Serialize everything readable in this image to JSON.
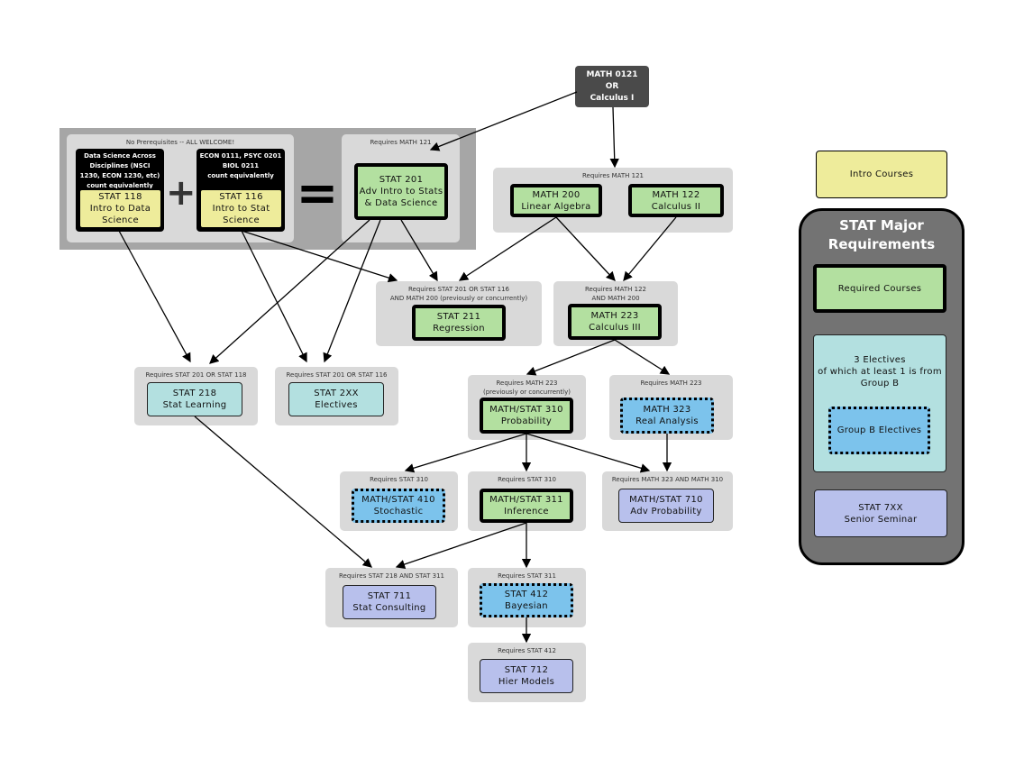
{
  "top_prereq": {
    "label": "MATH 0121\nOR\nCalculus I"
  },
  "intro_block": {
    "panel_label": "No Prerequisites -- ALL WELCOME!",
    "equivalents_118": "Data Science Across Disciplines (NSCI 1230, ECON 1230, etc) count equivalently",
    "equivalents_116": "ECON 0111, PSYC 0201\nBIOL 0211\ncount equivalently",
    "plus": "+",
    "equals": "="
  },
  "groups": [
    {
      "id": "g118",
      "courses": [
        {
          "code": "STAT 118",
          "name": "Intro to Data Science",
          "type": "intro"
        }
      ]
    },
    {
      "id": "g116",
      "courses": [
        {
          "code": "STAT 116",
          "name": "Intro to Stat Science",
          "type": "intro"
        }
      ]
    },
    {
      "id": "g201",
      "requires": "Requires MATH 121",
      "courses": [
        {
          "code": "STAT 201",
          "name": "Adv Intro to Stats & Data Science",
          "type": "required"
        }
      ]
    },
    {
      "id": "gmath",
      "requires": "Requires MATH 121",
      "courses": [
        {
          "code": "MATH 200",
          "name": "Linear Algebra",
          "type": "required"
        },
        {
          "code": "MATH 122",
          "name": "Calculus II",
          "type": "required"
        }
      ]
    },
    {
      "id": "g211",
      "requires": "Requires STAT 201 OR STAT 116\nAND MATH 200 (previously or concurrently)",
      "courses": [
        {
          "code": "STAT 211",
          "name": "Regression",
          "type": "required"
        }
      ]
    },
    {
      "id": "g223",
      "requires": "Requires MATH 122\nAND MATH 200",
      "courses": [
        {
          "code": "MATH 223",
          "name": "Calculus III",
          "type": "required"
        }
      ]
    },
    {
      "id": "g218",
      "requires": "Requires STAT 201 OR STAT 118",
      "courses": [
        {
          "code": "STAT 218",
          "name": "Stat Learning",
          "type": "elective"
        }
      ]
    },
    {
      "id": "g2xx",
      "requires": "Requires STAT 201 OR STAT 116",
      "courses": [
        {
          "code": "STAT 2XX",
          "name": "Electives",
          "type": "elective"
        }
      ]
    },
    {
      "id": "g310",
      "requires": "Requires MATH 223\n(previously or concurrently)",
      "courses": [
        {
          "code": "MATH/STAT 310",
          "name": "Probability",
          "type": "required"
        }
      ]
    },
    {
      "id": "g323",
      "requires": "Requires MATH 223",
      "courses": [
        {
          "code": "MATH 323",
          "name": "Real Analysis",
          "type": "groupb"
        }
      ]
    },
    {
      "id": "g410",
      "requires": "Requires STAT 310",
      "courses": [
        {
          "code": "MATH/STAT 410",
          "name": "Stochastic",
          "type": "groupb"
        }
      ]
    },
    {
      "id": "g311",
      "requires": "Requires STAT 310",
      "courses": [
        {
          "code": "MATH/STAT 311",
          "name": "Inference",
          "type": "required"
        }
      ]
    },
    {
      "id": "g710",
      "requires": "Requires MATH 323 AND MATH 310",
      "courses": [
        {
          "code": "MATH/STAT 710",
          "name": "Adv Probability",
          "type": "senior"
        }
      ]
    },
    {
      "id": "g711",
      "requires": "Requires STAT 218  AND STAT 311",
      "courses": [
        {
          "code": "STAT 711",
          "name": "Stat Consulting",
          "type": "senior"
        }
      ]
    },
    {
      "id": "g412",
      "requires": "Requires STAT 311",
      "courses": [
        {
          "code": "STAT 412",
          "name": "Bayesian",
          "type": "groupb"
        }
      ]
    },
    {
      "id": "g712",
      "requires": "Requires STAT 412",
      "courses": [
        {
          "code": "STAT 712",
          "name": "Hier Models",
          "type": "senior"
        }
      ]
    }
  ],
  "legend": {
    "intro": "Intro Courses",
    "major_title": "STAT Major\nRequirements",
    "required": "Required Courses",
    "electives": "3 Electives\nof which at least 1 is from\nGroup B",
    "groupb": "Group B Electives",
    "senior": "STAT 7XX\nSenior Seminar"
  },
  "colors": {
    "intro": "#eeec9b",
    "required": "#b3e0a0",
    "elective": "#b3e0e0",
    "groupb": "#7cc3ec",
    "senior": "#b8c0ec",
    "panel": "#d9d9d9"
  }
}
